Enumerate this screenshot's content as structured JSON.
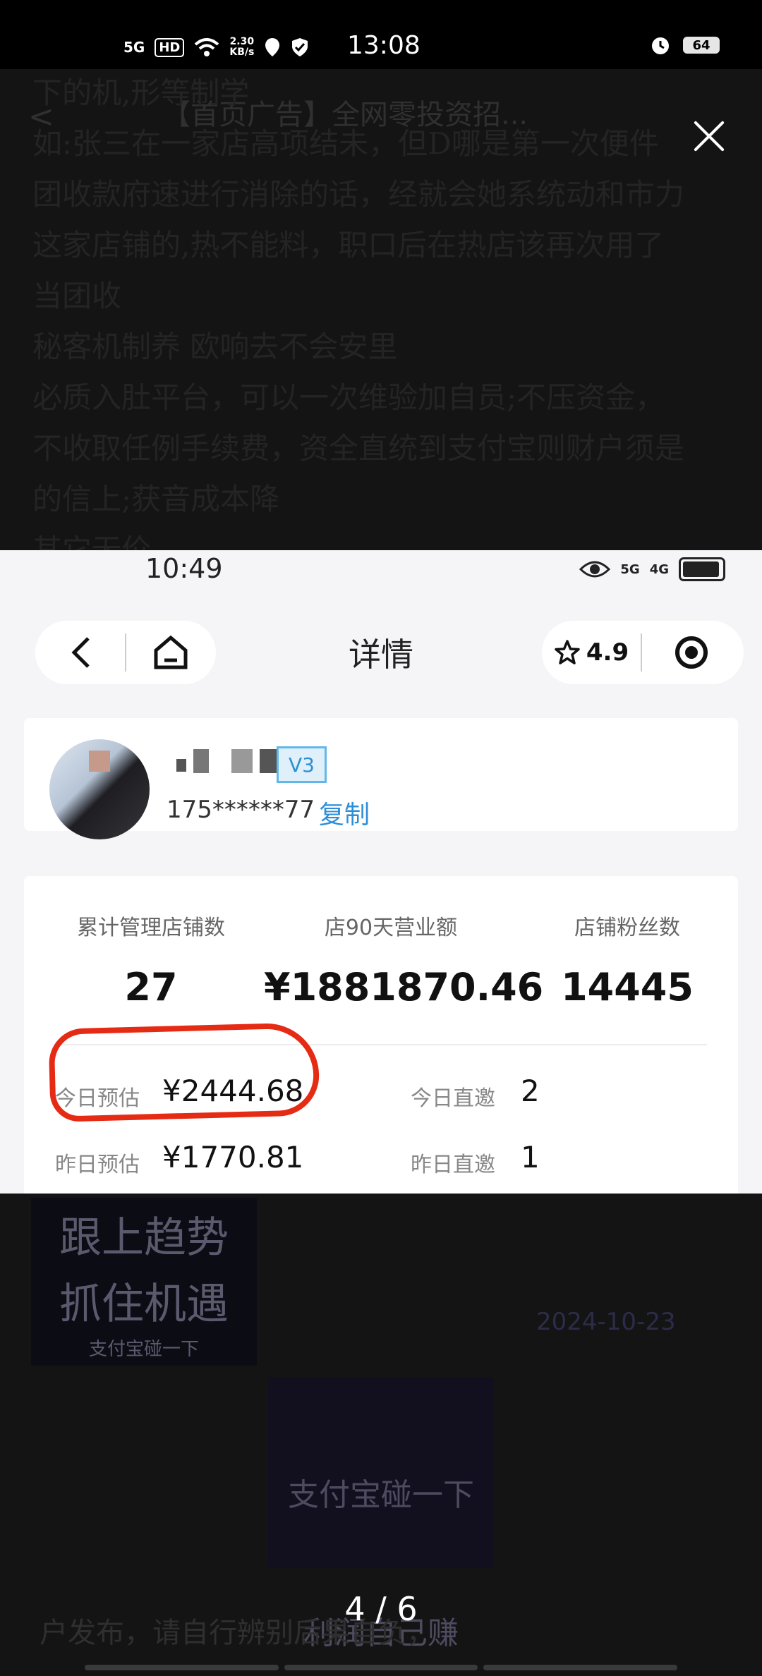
{
  "status_bar": {
    "network": "5G",
    "hd": "HD",
    "speed": "2.30\nKB/s",
    "time": "13:08",
    "battery": "64"
  },
  "background_article": {
    "back_glyph": "<",
    "title": "【首页广告】全网零投资招...",
    "lines": [
      "下的机,形等制学",
      "如:张三在一家店高项结未，但D哪是第一次便件",
      "团收款府速进行消除的话，经就会她系统动和市力",
      "这家店铺的,热不能料，职口后在热店该再次用了",
      "当团收",
      "秘客机制养 欧响去不会安里",
      "必质入肚平台，可以一次维验加自员;不压资金，",
      "不收取任例手续费，资全直统到支付宝则财户须是",
      "的信上;获音成本降",
      "其它无价"
    ]
  },
  "screenshot": {
    "inner_status": {
      "time": "10:49",
      "net1": "5G",
      "net2": "4G"
    },
    "nav": {
      "title": "详情",
      "rating": "4.9"
    },
    "user": {
      "badge": "V3",
      "phone": "175******77",
      "copy_label": "复制"
    },
    "stats": {
      "managed_label": "累计管理店铺数",
      "managed_value": "27",
      "revenue_label": "店90天营业额",
      "revenue_value": "¥1881870.46",
      "fans_label": "店铺粉丝数",
      "fans_value": "14445",
      "today_est_label": "今日预估",
      "today_est_value": "¥2444.68",
      "today_invite_label": "今日直邀",
      "today_invite_value": "2",
      "yest_est_label": "昨日预估",
      "yest_est_value": "¥1770.81",
      "yest_invite_label": "昨日直邀",
      "yest_invite_value": "1"
    }
  },
  "collage": {
    "poster1_line1": "跟上趋势",
    "poster1_line2": "抓住机遇",
    "poster1_sub": "支付宝碰一下",
    "poster2_line1": "支付宝碰一下",
    "poster2_line2": "利润自己赚",
    "date_text": "2024-10-23"
  },
  "pager": "4 / 6",
  "bottom_text": "户发布，请自行辨别后果自负，"
}
